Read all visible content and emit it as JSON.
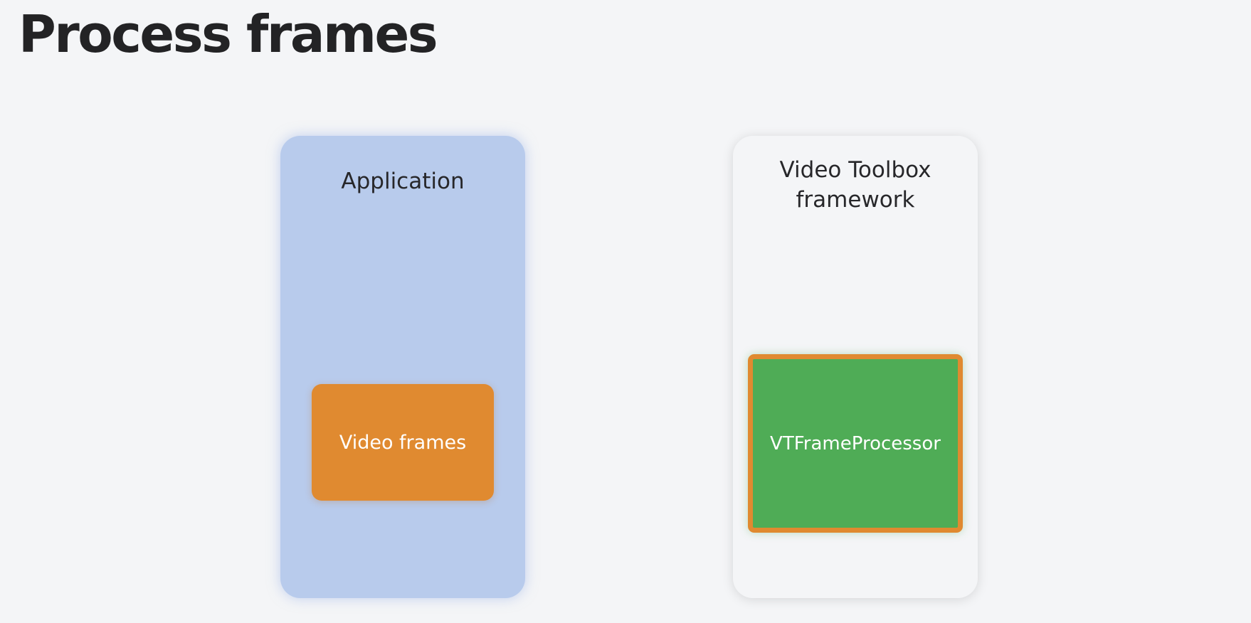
{
  "title": "Process frames",
  "panels": {
    "application": {
      "label": "Application",
      "box": "Video frames"
    },
    "video_toolbox": {
      "label": "Video Toolbox\nframework",
      "box": "VTFrameProcessor"
    }
  },
  "colors": {
    "background": "#f4f5f7",
    "application_panel": "#b8cbec",
    "video_toolbox_panel": "#f4f5f7",
    "video_frames_box": "#e08a30",
    "frame_processor_box": "#4fac56",
    "frame_processor_border": "#e08a30"
  }
}
